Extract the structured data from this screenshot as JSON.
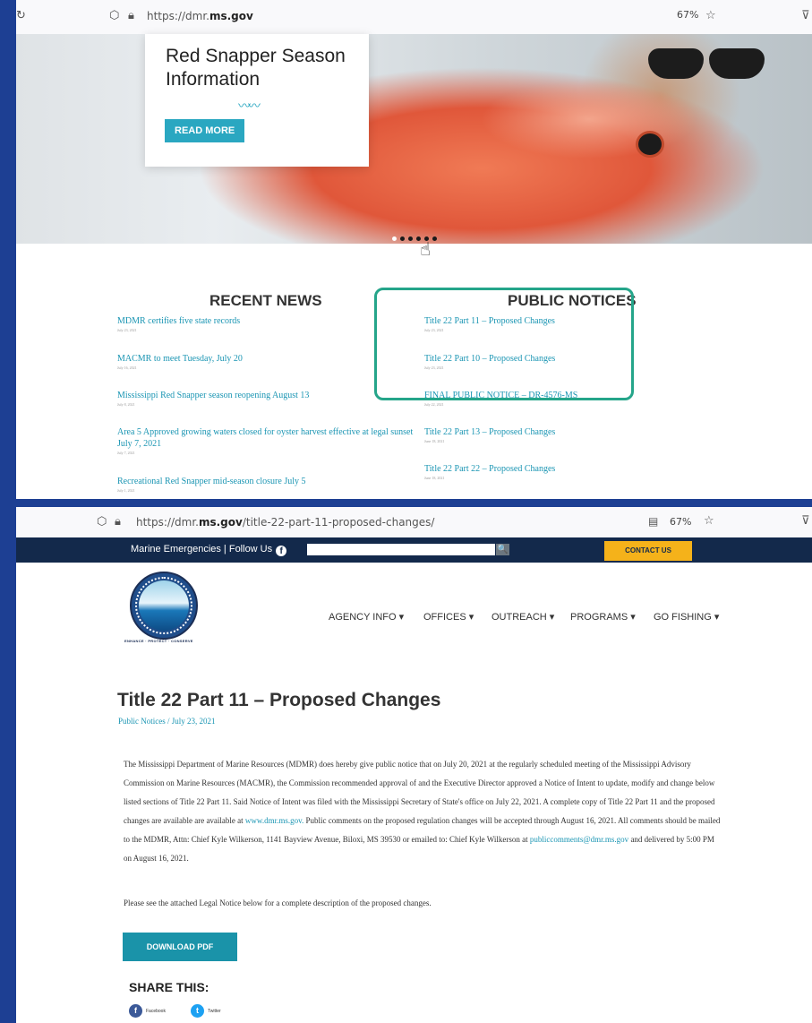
{
  "top_window": {
    "url_prefix": "https://dmr.",
    "url_domain": "ms.gov",
    "zoom": "67%",
    "hero": {
      "title": "Red Snapper Season Information",
      "squiggle": "〰〰",
      "button": "READ MORE"
    },
    "recent_news_heading": "RECENT NEWS",
    "public_notices_heading": "PUBLIC NOTICES",
    "recent_news": [
      {
        "title": "MDMR certifies five state records",
        "date": "July 23, 2021"
      },
      {
        "title": "MACMR to meet Tuesday, July 20",
        "date": "July 16, 2021"
      },
      {
        "title": "Mississippi Red Snapper season reopening August 13",
        "date": "July 8, 2021"
      },
      {
        "title": "Area 5 Approved growing waters closed for oyster harvest effective at legal sunset July 7, 2021",
        "date": "July 7, 2021"
      },
      {
        "title": "Recreational Red Snapper mid-season closure July 5",
        "date": "July 1, 2021"
      }
    ],
    "public_notices": [
      {
        "title": "Title 22 Part 11 – Proposed Changes",
        "date": "July 23, 2021"
      },
      {
        "title": "Title 22 Part 10 – Proposed Changes",
        "date": "July 23, 2021"
      },
      {
        "title": "FINAL PUBLIC NOTICE – DR-4576-MS",
        "date": "July 22, 2021"
      },
      {
        "title": "Title 22 Part 13 – Proposed Changes",
        "date": "June 18, 2021"
      },
      {
        "title": "Title 22 Part 22 – Proposed Changes",
        "date": "June 18, 2021"
      }
    ]
  },
  "bottom_window": {
    "url_prefix": "https://dmr.",
    "url_domain": "ms.gov",
    "url_path": "/title-22-part-11-proposed-changes/",
    "zoom": "67%",
    "topbar": {
      "emergencies": "Marine Emergencies | Follow Us",
      "facebook_glyph": "f",
      "search_glyph": "🔍",
      "contact": "CONTACT US"
    },
    "tagline": "ENHANCE · PROTECT · CONSERVE",
    "nav": [
      "AGENCY INFO ▾",
      "OFFICES ▾",
      "OUTREACH ▾",
      "PROGRAMS ▾",
      "GO FISHING ▾"
    ],
    "page_title": "Title 22 Part 11 – Proposed Changes",
    "breadcrumb": "Public Notices / July 23, 2021",
    "body": {
      "part1": "The Mississippi Department of Marine Resources (MDMR) does hereby give public notice that on July 20, 2021 at the regularly scheduled meeting of the Mississippi Advisory Commission on Marine Resources (MACMR), the Commission recommended approval of and the Executive Director approved a Notice of Intent to update, modify and change below listed sections of Title 22 Part 11. Said Notice of Intent was filed with the Mississippi Secretary of State's office on July  22, 2021. A complete copy of Title 22 Part 11 and the proposed changes are available are available at ",
      "link1": "www.dmr.ms.gov.",
      "part2": " Public comments on the proposed regulation changes will be accepted through August 16, 2021. All comments should be mailed to the MDMR, Attn: Chief Kyle Wilkerson, 1141 Bayview Avenue, Biloxi, MS 39530 or emailed to: Chief Kyle Wilkerson at ",
      "link2": "publiccomments@dmr.ms.gov",
      "part3": " and delivered by 5:00 PM on August 16, 2021."
    },
    "legal_notice": "Please see the attached Legal Notice below for a complete description of the proposed changes.",
    "download_button": "DOWNLOAD PDF",
    "share_heading": "SHARE THIS:",
    "share_buttons": [
      {
        "glyph": "f",
        "label": "Facebook",
        "color": "#3b5998"
      },
      {
        "glyph": "t",
        "label": "Twitter",
        "color": "#1da1f2"
      }
    ]
  },
  "colors": {
    "accent": "#2aa7c1",
    "highlight_box": "#25a58a",
    "header_navy": "#13294b",
    "contact_gold": "#f5b21a",
    "background": "#1d3f93"
  }
}
